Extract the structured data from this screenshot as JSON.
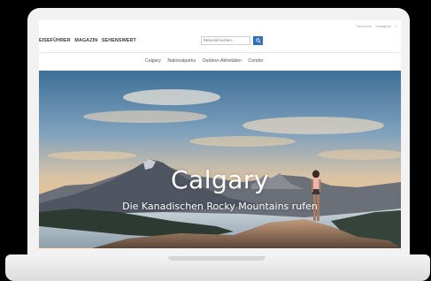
{
  "header": {
    "nav": [
      "EISEFÜHRER",
      "MAGAZIN",
      "SEHENSWERT"
    ],
    "search": {
      "placeholder": "Reiseziel suchen..."
    },
    "social": [
      "Facebook",
      "Instagram",
      "Y"
    ]
  },
  "subnav": [
    "Calgary",
    "Nationalparks",
    "Outdoor-Aktivitäten",
    "Condor"
  ],
  "hero": {
    "title": "Calgary",
    "subtitle": "Die Kanadischen Rocky Mountains rufen"
  },
  "colors": {
    "accent": "#2e6fb6",
    "device": "#f2f2f2"
  },
  "icons": [
    "search-icon"
  ]
}
